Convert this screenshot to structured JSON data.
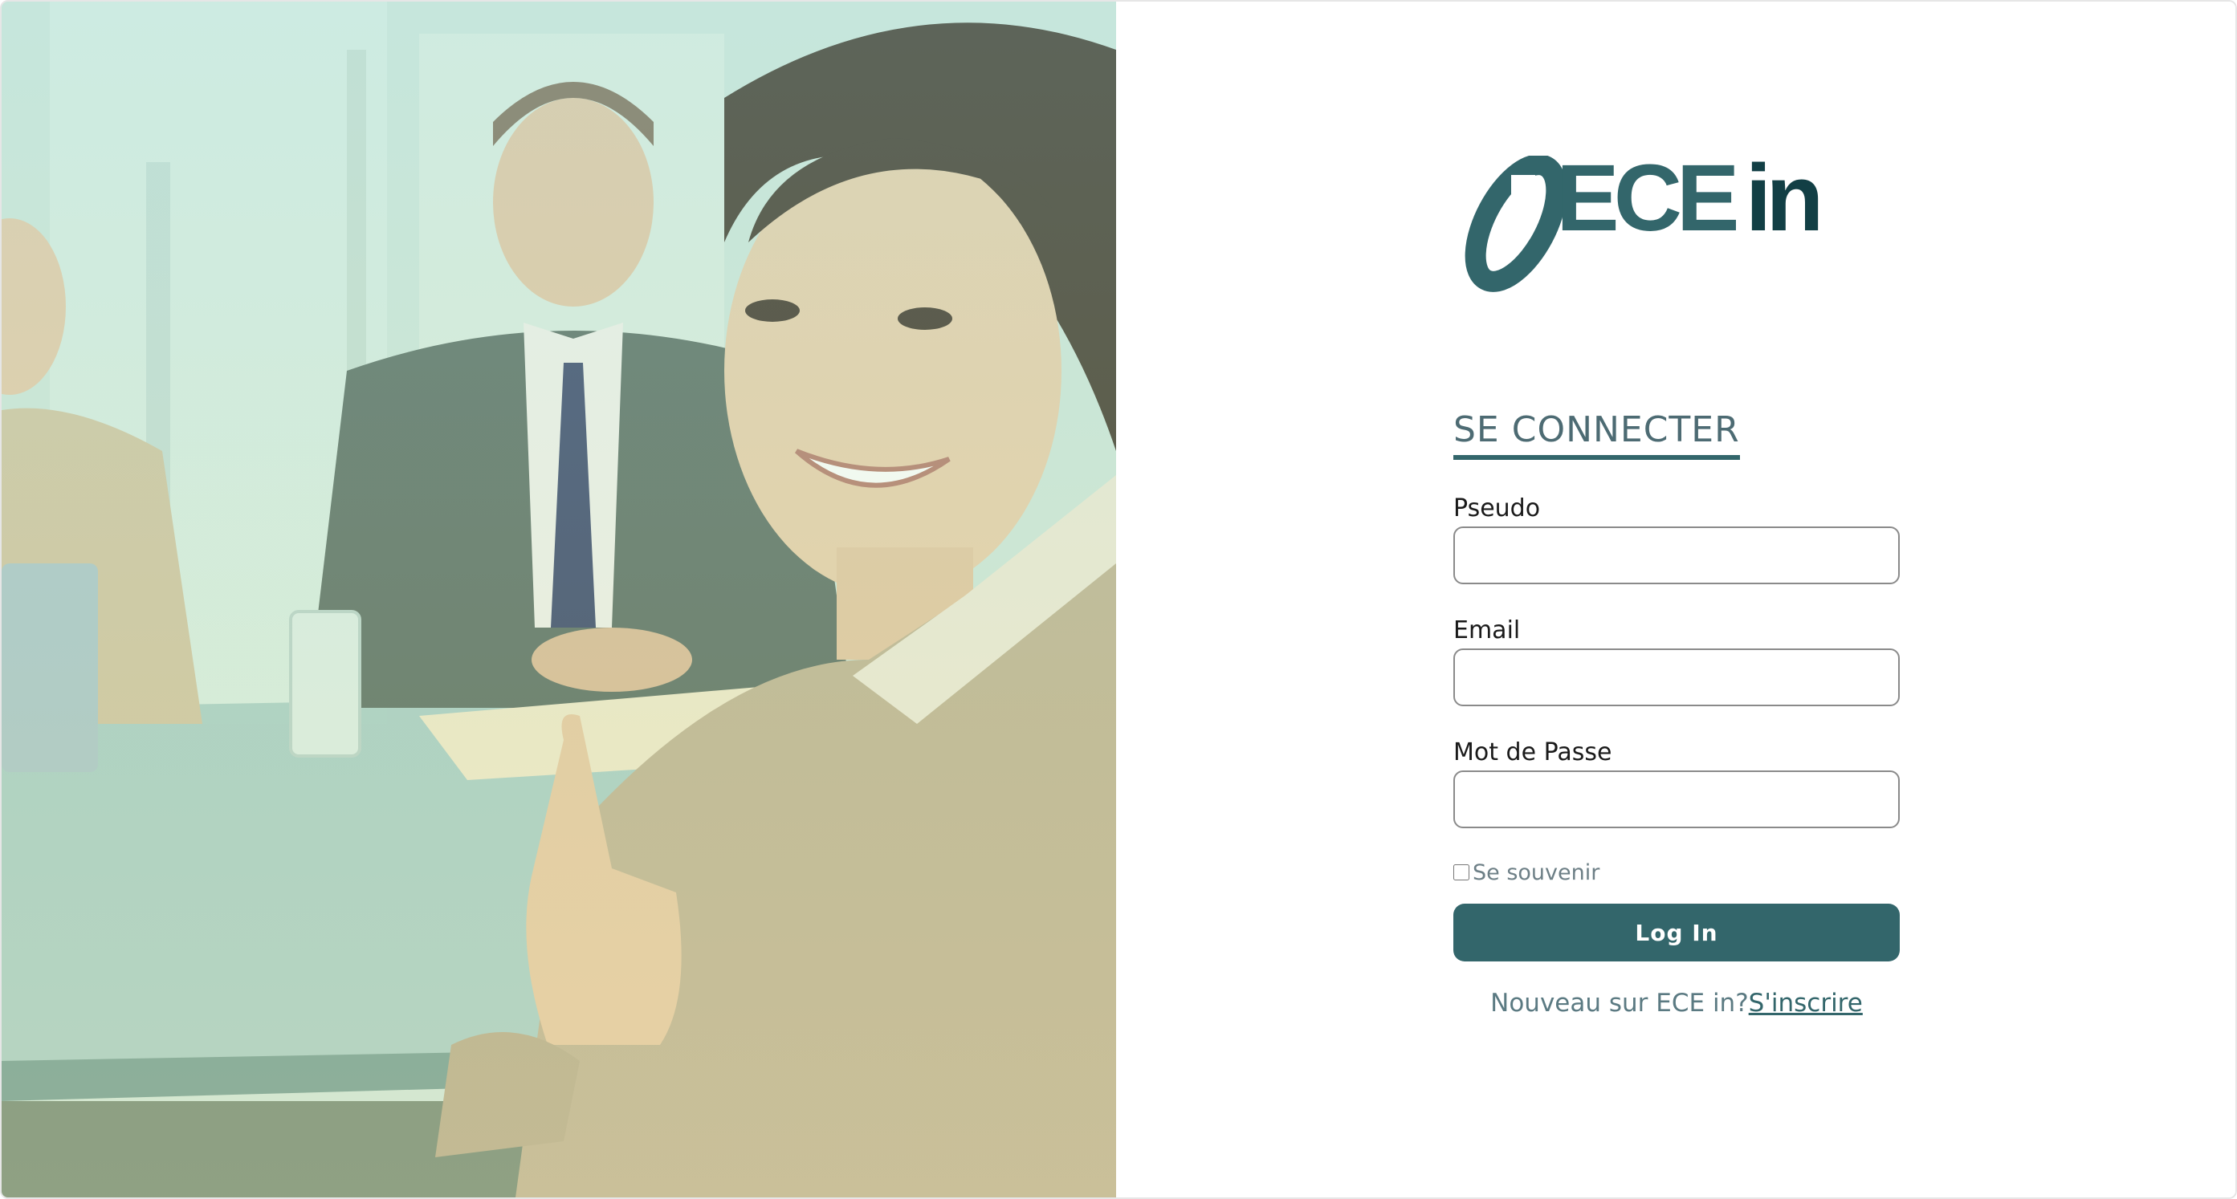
{
  "brand": {
    "name_part1": "ECE",
    "name_part2": "in",
    "color_primary": "#33666b",
    "color_dark": "#123f45"
  },
  "photo": {
    "icon": "office-people-photo"
  },
  "login": {
    "title": "SE CONNECTER",
    "pseudo_label": "Pseudo",
    "pseudo_value": "",
    "email_label": "Email",
    "email_value": "",
    "password_label": "Mot de Passe",
    "password_value": "",
    "remember_label": "Se souvenir",
    "remember_checked": false,
    "submit_label": "Log In",
    "signup_prompt": "Nouveau sur ECE in?",
    "signup_link": "S'inscrire"
  }
}
